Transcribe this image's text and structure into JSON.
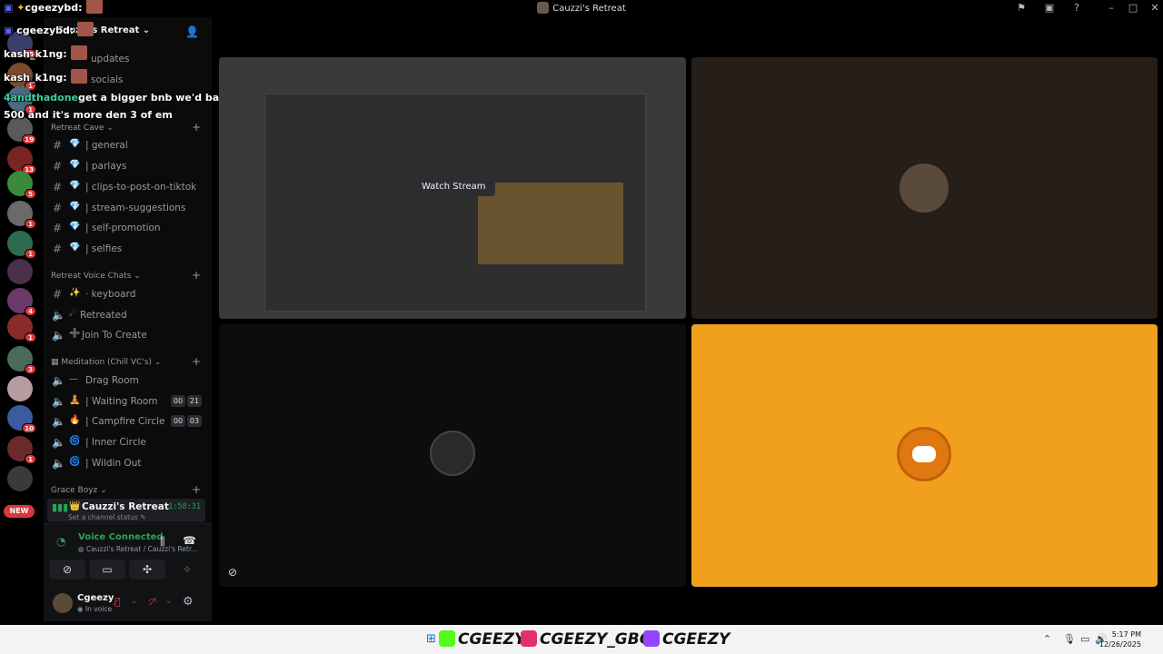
{
  "window": {
    "title": "Cauzzi's Retreat"
  },
  "overlay": [
    {
      "user": "cgeezybd:",
      "msg": ""
    },
    {
      "user": "cgeezybd:",
      "msg": ""
    },
    {
      "user": "kash_k1ng:",
      "msg": ""
    },
    {
      "user": "kash_k1ng:",
      "msg": ""
    },
    {
      "user": "4andthadone",
      "msg": "get a bigger bnb we'd bak just put"
    },
    {
      "user": "",
      "msg": "500 and it's more den 3 of em"
    }
  ],
  "server": {
    "name": "Cauzzi's Retreat"
  },
  "rail": {
    "badges": [
      "15",
      "1",
      "1",
      "19",
      "13",
      "5",
      "1",
      "1",
      "4",
      "1",
      "3",
      "10",
      "1"
    ],
    "new_label": "NEW"
  },
  "channels_top": [
    {
      "name": "updates"
    },
    {
      "name": "socials"
    }
  ],
  "categories": {
    "cave": "Retreat Cave",
    "voice": "Retreat Voice Chats",
    "meditation": "Meditation (Chill VC's)",
    "grace": "Grace Boyz"
  },
  "cave_channels": [
    {
      "emoji": "💎",
      "name": "| general"
    },
    {
      "emoji": "💎",
      "name": "| parlays"
    },
    {
      "emoji": "💎",
      "name": "| clips-to-post-on-tiktok"
    },
    {
      "emoji": "💎",
      "name": "| stream-suggestions"
    },
    {
      "emoji": "💎",
      "name": "| self-promotion"
    },
    {
      "emoji": "💎",
      "name": "| selfies"
    }
  ],
  "voice_channels": [
    {
      "emoji": "✨",
      "name": "· keyboard"
    },
    {
      "emoji": "☄",
      "name": "Retreated"
    },
    {
      "emoji": "➕",
      "name": "Join To Create"
    }
  ],
  "meditation_channels": [
    {
      "emoji": "—",
      "name": "Drag Room",
      "c1": "",
      "c2": ""
    },
    {
      "emoji": "🧘",
      "name": "| Waiting Room",
      "c1": "00",
      "c2": "21"
    },
    {
      "emoji": "🔥",
      "name": "| Campfire Circle",
      "c1": "00",
      "c2": "03"
    },
    {
      "emoji": "🌀",
      "name": "| Inner Circle",
      "c1": "",
      "c2": ""
    },
    {
      "emoji": "🌀",
      "name": "| Wildin Out",
      "c1": "",
      "c2": ""
    }
  ],
  "active_channel": {
    "name": "Cauzzi's Retreat",
    "status": "Set a channel status",
    "timer": "1:58:31"
  },
  "voice": {
    "title": "Voice Connected",
    "subtitle": "Cauzzi's Retreat / Cauzzi's Retr..."
  },
  "user": {
    "name": "Cgeezy",
    "status": "In voice"
  },
  "stream": {
    "watch_label": "Watch Stream"
  },
  "taskbar": {
    "tags": [
      "CGEEZY",
      "CGEEZY_GBC",
      "CGEEZY"
    ],
    "time": "5:17 PM",
    "date": "12/26/2025"
  },
  "colors": {
    "accent_green": "#23a55a",
    "tile_orange": "#f0a01d",
    "badge_red": "#da373c"
  }
}
